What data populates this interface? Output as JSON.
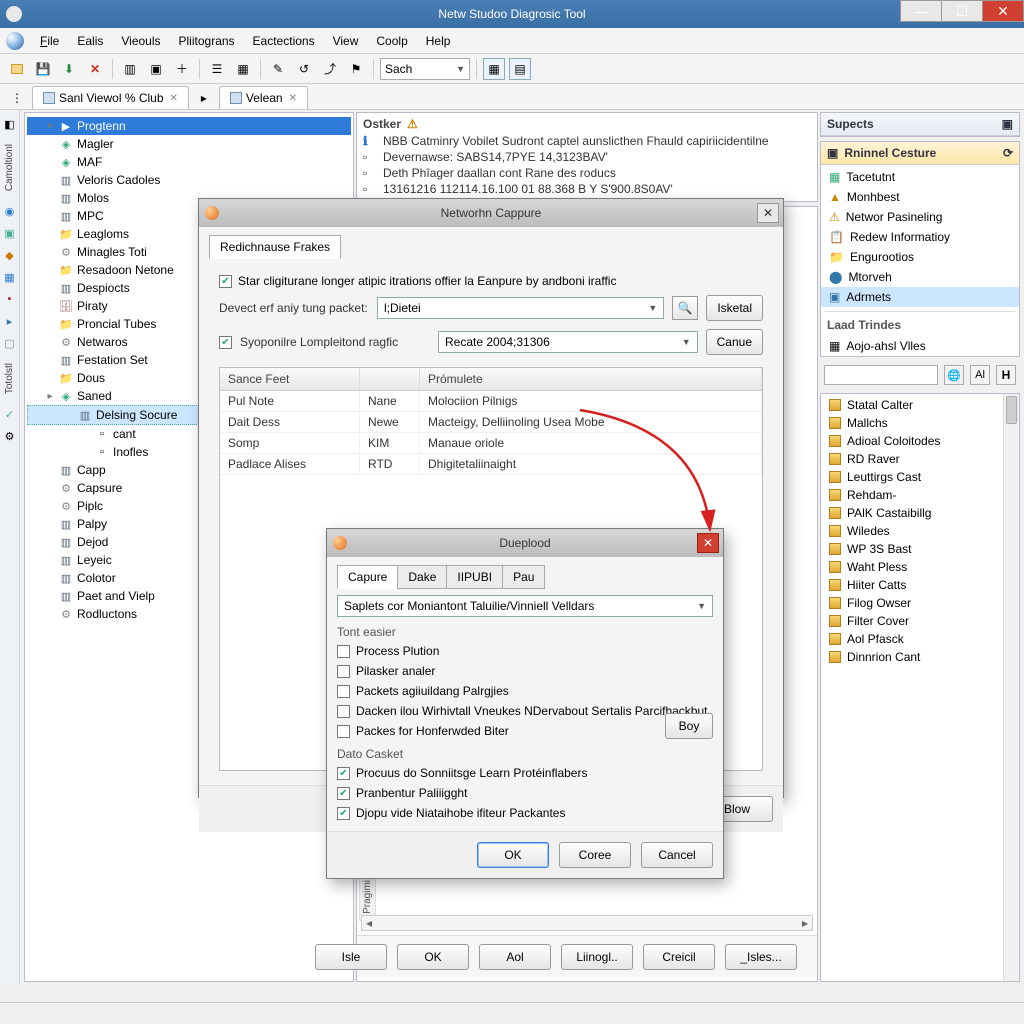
{
  "titlebar": {
    "title": "Netw Studoo Diagrosic Tool"
  },
  "menu": [
    "File",
    "Ealis",
    "Vieouls",
    "Pliitograns",
    "Eactections",
    "View",
    "Coolp",
    "Help"
  ],
  "toolbar": {
    "search_value": "Sach"
  },
  "tabs": [
    {
      "label": "Sanl Viewol % Club",
      "closable": true
    },
    {
      "label": "Velean",
      "closable": true
    }
  ],
  "left_rail": {
    "labels": [
      "Camoltionl",
      "Totolstl"
    ]
  },
  "tree": [
    {
      "lvl": 1,
      "label": "Progtenn",
      "sel": true,
      "tw": "▾",
      "icon": "play"
    },
    {
      "lvl": 1,
      "label": "Magler",
      "icon": "node"
    },
    {
      "lvl": 1,
      "label": "MAF",
      "icon": "node"
    },
    {
      "lvl": 1,
      "label": "Veloris Cadoles",
      "icon": "doc"
    },
    {
      "lvl": 1,
      "label": "Molos",
      "icon": "doc"
    },
    {
      "lvl": 1,
      "label": "MPC",
      "icon": "doc"
    },
    {
      "lvl": 1,
      "label": "Leagloms",
      "icon": "folder"
    },
    {
      "lvl": 1,
      "label": "Minagles Toti",
      "icon": "gear"
    },
    {
      "lvl": 1,
      "label": "Resadoon Netone",
      "icon": "folder"
    },
    {
      "lvl": 1,
      "label": "Despiocts",
      "icon": "doc"
    },
    {
      "lvl": 1,
      "label": "Piraty",
      "icon": "db"
    },
    {
      "lvl": 1,
      "label": "Proncial Tubes",
      "icon": "folder"
    },
    {
      "lvl": 1,
      "label": "Netwaros",
      "icon": "gear"
    },
    {
      "lvl": 1,
      "label": "Festation Set",
      "icon": "doc"
    },
    {
      "lvl": 1,
      "label": "Dous",
      "icon": "folder"
    },
    {
      "lvl": 1,
      "label": "Saned",
      "tw": "▸",
      "icon": "node"
    },
    {
      "lvl": 2,
      "label": "Delsing Socure",
      "hl": true,
      "icon": "doc"
    },
    {
      "lvl": 3,
      "label": "cant",
      "icon": "item"
    },
    {
      "lvl": 3,
      "label": "Inofles",
      "icon": "item"
    },
    {
      "lvl": 1,
      "label": "Capp",
      "icon": "doc"
    },
    {
      "lvl": 1,
      "label": "Capsure",
      "icon": "gear"
    },
    {
      "lvl": 1,
      "label": "Piplc",
      "icon": "gear"
    },
    {
      "lvl": 1,
      "label": "Palpy",
      "icon": "doc"
    },
    {
      "lvl": 1,
      "label": "Dejod",
      "icon": "doc"
    },
    {
      "lvl": 1,
      "label": "Leyeic",
      "icon": "doc"
    },
    {
      "lvl": 1,
      "label": "Colotor",
      "icon": "doc"
    },
    {
      "lvl": 1,
      "label": "Paet and Vielp",
      "icon": "doc"
    },
    {
      "lvl": 1,
      "label": "Rodluctons",
      "icon": "gear"
    }
  ],
  "log": {
    "header": "Ostker",
    "lines": [
      "NBB Catminry Vobilet Sudront captel aunslicthen Fhauld capiriicidentilne",
      "Devernawse: SABS14,7PYE 14,3123BAV'",
      "Deth Phîager daallan cont Rane des roducs",
      "13161216 112114.16.100 01 88.368 B Y S'900.8S0AV'"
    ]
  },
  "bottom_vlabel": "Pragimi",
  "bottom_buttons": [
    "Isle",
    "OK",
    "Aol",
    "Liinogl..",
    "Creicil",
    "_Isles..."
  ],
  "right": {
    "suspects_title": "Supects",
    "panel1": {
      "title": "Rninnel Cesture",
      "items": [
        "Tacetutnt",
        "Monhbest",
        "Networ Pasineling",
        "Redew Informatioy",
        "Engurootios",
        "Mtorveh",
        "Adrmets"
      ],
      "sel_index": 6,
      "foot_label": "Laad Trindes",
      "foot_item": "Aojo-ahsl Vlles"
    },
    "list": [
      "Statal Calter",
      "Mallchs",
      "Adioal Coloitodes",
      "RD Raver",
      "Leuttirgs Cast",
      "Rehdam-",
      "PAlK Castaibillg",
      "Wiledes",
      "WP 3S Bast",
      "Waht Pless",
      "Hiiter Catts",
      "Filog Owser",
      "Filter Cover",
      "Aol Pfasck",
      "Dinnrion Cant"
    ]
  },
  "dialog1": {
    "title": "Networhn Cappure",
    "tab": "Redichnause Frakes",
    "chk1": {
      "checked": true,
      "label": "Star cligiturane longer atipic itrations offier la Eanpure by andboni iraffic"
    },
    "row1_label": "Devect erf aniy tung packet:",
    "row1_value": "l;Dietei",
    "row1_btn": "Isketal",
    "chk2": {
      "checked": true,
      "label": "Syoponilre Lompleitond ragfic"
    },
    "row2_value": "Recate 2004;31306",
    "row2_btn": "Canue",
    "grid": {
      "headers": [
        "Sance Feet",
        "",
        "Prómulete"
      ],
      "rows": [
        [
          "Pul Note",
          "Nane",
          "Molociion Pilnigs"
        ],
        [
          "Dait Dess",
          "Newe",
          "Macteigy, Delliinoling Usea Mobe"
        ],
        [
          "Somp",
          "KIM",
          "Manaue oriole"
        ],
        [
          "Padlace Alises",
          "RTD",
          "Dhigitetaliinaight"
        ]
      ]
    },
    "footer_btn": "Blow"
  },
  "dialog2": {
    "title": "Dueplood",
    "tabs": [
      "Capure",
      "Dake",
      "IIPUBI",
      "Pau"
    ],
    "active_tab": 0,
    "combo_value": "Saplets cor Moniantont Taluilie/Vinniell Velldars",
    "group1": "Tont easier",
    "g1_items": [
      {
        "c": false,
        "label": "Process Plution"
      },
      {
        "c": false,
        "label": "Pilasker analer"
      },
      {
        "c": false,
        "label": "Packets agiiuildang Palrgjies"
      },
      {
        "c": false,
        "label": "Dacken ilou Wirhivtall Vneukes NDervabout Sertalis Parcifhackbut"
      },
      {
        "c": false,
        "label": "Packes for Honferwded Biter"
      }
    ],
    "side_btn": "Boy",
    "group2": "Dato Casket",
    "g2_items": [
      {
        "c": true,
        "label": "Procuus do Sonniitsge Learn Protéinflabers"
      },
      {
        "c": true,
        "label": "Pranbentur Paliiigght"
      },
      {
        "c": true,
        "label": "Djopu vide Niataihobe ifiteur Packantes"
      }
    ],
    "footer": [
      "OK",
      "Coree",
      "Cancel"
    ]
  }
}
